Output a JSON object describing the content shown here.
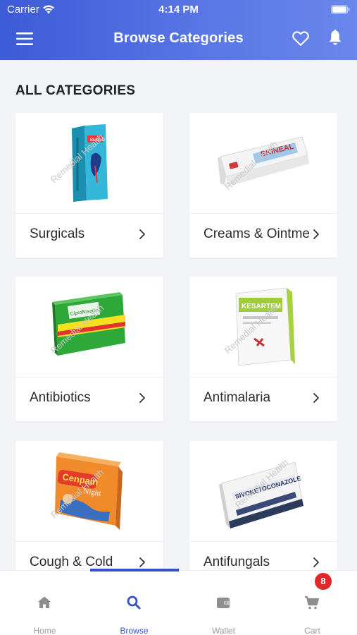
{
  "status_bar": {
    "carrier": "Carrier",
    "time": "4:14 PM"
  },
  "header": {
    "title": "Browse Categories"
  },
  "section": {
    "title": "ALL CATEGORIES"
  },
  "categories": [
    {
      "label": "Surgicals"
    },
    {
      "label": "Creams & Ointments"
    },
    {
      "label": "Antibiotics"
    },
    {
      "label": "Antimalaria"
    },
    {
      "label": "Cough & Cold"
    },
    {
      "label": "Antifungals"
    }
  ],
  "product_text": {
    "surgicals": "BLOOD",
    "creams": "SKINEAL",
    "antibiotics": "Ciprofloxacin",
    "antimalaria": "KESARTEM",
    "cough": "Cenpain",
    "cough_sub": "Night",
    "antifungals": "SIVOKETOCONAZOLE"
  },
  "watermark": "Remedial Health",
  "tabbar": {
    "tabs": [
      {
        "label": "Home",
        "icon": "home-icon"
      },
      {
        "label": "Browse",
        "icon": "search-icon"
      },
      {
        "label": "Wallet",
        "icon": "wallet-icon"
      },
      {
        "label": "Cart",
        "icon": "cart-icon"
      }
    ],
    "active": "Browse",
    "cart_badge": "8"
  },
  "colors": {
    "header_start": "#3c5bd6",
    "header_end": "#6a87ec",
    "active_tab": "#3551c7",
    "badge": "#e0272c",
    "inactive_tab": "#9b9b9b"
  }
}
